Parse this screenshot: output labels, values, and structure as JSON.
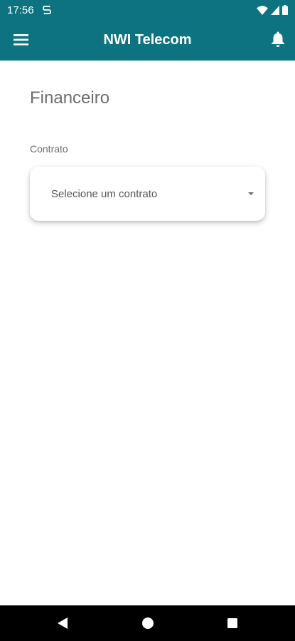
{
  "status_bar": {
    "time": "17:56",
    "icons": [
      "sync-icon",
      "wifi-icon",
      "signal-icon",
      "battery-icon"
    ]
  },
  "app_bar": {
    "title": "NWI Telecom",
    "menu_icon": "hamburger-menu-icon",
    "notification_icon": "bell-icon"
  },
  "page": {
    "title": "Financeiro",
    "contract_label": "Contrato",
    "contract_select": {
      "value": "Selecione um contrato",
      "icon": "dropdown-arrow-icon"
    }
  },
  "nav_bar": {
    "buttons": [
      "back-icon",
      "home-icon",
      "recents-icon"
    ]
  },
  "colors": {
    "primary": "#0d7381",
    "text_muted": "#6d6d6d",
    "background": "#ffffff",
    "nav_bar": "#000000"
  }
}
